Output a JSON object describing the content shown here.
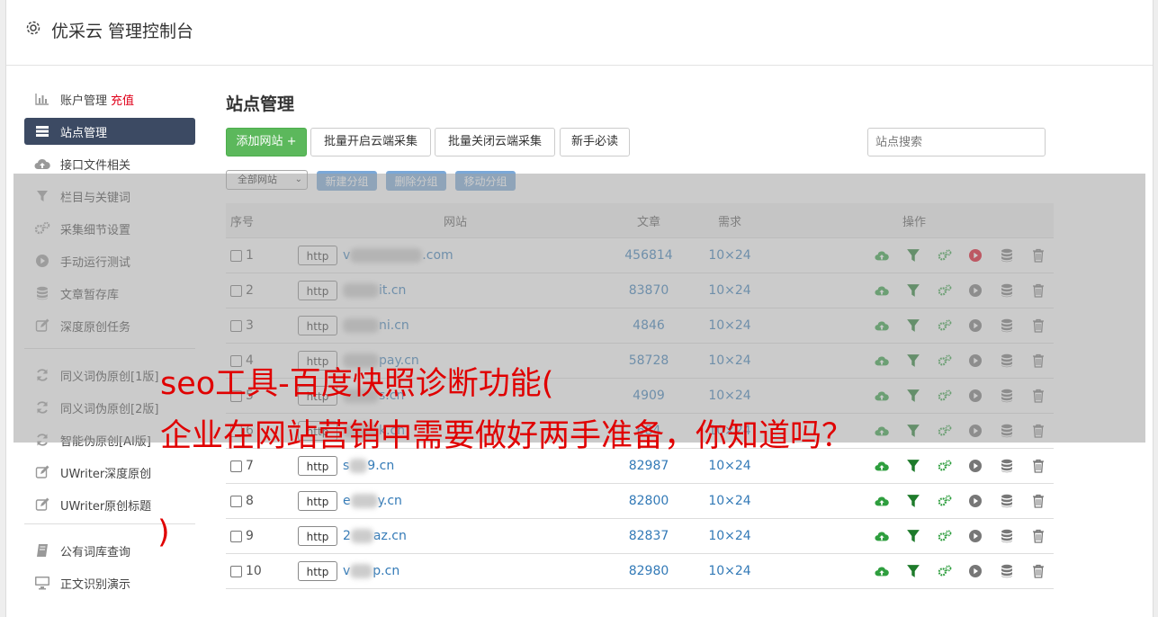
{
  "header": {
    "title": "优采云 管理控制台"
  },
  "sidebar": {
    "items": [
      {
        "label": "账户管理",
        "badge": "充值",
        "icon": "bar-chart-icon"
      },
      {
        "label": "站点管理",
        "icon": "server-icon",
        "active": true
      },
      {
        "label": "接口文件相关",
        "icon": "cloud-upload-icon"
      },
      {
        "label": "栏目与关键词",
        "icon": "filter-icon"
      },
      {
        "label": "采集细节设置",
        "icon": "gears-icon"
      },
      {
        "label": "手动运行测试",
        "icon": "play-icon"
      },
      {
        "label": "文章暂存库",
        "icon": "database-icon"
      },
      {
        "label": "深度原创任务",
        "icon": "edit-icon"
      }
    ],
    "items2": [
      {
        "label": "同义词伪原创[1版]",
        "icon": "refresh-icon"
      },
      {
        "label": "同义词伪原创[2版]",
        "icon": "refresh-icon"
      },
      {
        "label": "智能伪原创[AI版]",
        "icon": "refresh-icon"
      },
      {
        "label": "UWriter深度原创",
        "icon": "edit-icon"
      },
      {
        "label": "UWriter原创标题",
        "icon": "edit-icon"
      }
    ],
    "items3": [
      {
        "label": "公有词库查询",
        "icon": "book-icon"
      },
      {
        "label": "正文识别演示",
        "icon": "monitor-icon"
      }
    ]
  },
  "main": {
    "title": "站点管理",
    "buttons": {
      "add_site": "添加网站 +",
      "batch_open": "批量开启云端采集",
      "batch_close": "批量关闭云端采集",
      "guide": "新手必读"
    },
    "search_placeholder": "站点搜索",
    "group_select": "全部网站",
    "group_buttons": {
      "new": "新建分组",
      "delete": "删除分组",
      "move": "移动分组"
    },
    "table": {
      "headers": {
        "no": "序号",
        "site": "网站",
        "articles": "文章",
        "demand": "需求",
        "ops": "操作"
      },
      "rows": [
        {
          "no": "1",
          "protocol": "http",
          "site_prefix": "v",
          "site_suffix": ".com",
          "articles": "456814",
          "demand": "10×24"
        },
        {
          "no": "2",
          "protocol": "http",
          "site_prefix": "",
          "site_suffix": "it.cn",
          "articles": "83870",
          "demand": "10×24"
        },
        {
          "no": "3",
          "protocol": "http",
          "site_prefix": "",
          "site_suffix": "ni.cn",
          "articles": "4846",
          "demand": "10×24"
        },
        {
          "no": "4",
          "protocol": "http",
          "site_prefix": "",
          "site_suffix": "pay.cn",
          "articles": "58728",
          "demand": "10×24"
        },
        {
          "no": "5",
          "protocol": "http",
          "site_prefix": "",
          "site_suffix": "s.cn",
          "articles": "4909",
          "demand": "10×24"
        },
        {
          "no": "6",
          "protocol": "http",
          "site_prefix": "",
          "site_suffix": "k.cn",
          "articles": "684",
          "demand": "10×24"
        },
        {
          "no": "7",
          "protocol": "http",
          "site_prefix": "s",
          "site_suffix": "9.cn",
          "articles": "82987",
          "demand": "10×24"
        },
        {
          "no": "8",
          "protocol": "http",
          "site_prefix": "e",
          "site_suffix": "y.cn",
          "articles": "82800",
          "demand": "10×24"
        },
        {
          "no": "9",
          "protocol": "http",
          "site_prefix": "2",
          "site_suffix": "az.cn",
          "articles": "82837",
          "demand": "10×24"
        },
        {
          "no": "10",
          "protocol": "http",
          "site_prefix": "v",
          "site_suffix": "p.cn",
          "articles": "82980",
          "demand": "10×24"
        }
      ]
    }
  },
  "overlay": {
    "line1": "seo工具-百度快照诊断功能(",
    "line2": "企业在网站营销中需要做好两手准备，你知道吗？",
    "line3": ")"
  },
  "colors": {
    "active_nav": "#3c4a63",
    "green": "#5cb85c",
    "link": "#337ab7",
    "red_badge": "#e0001a",
    "overlay_text": "#e00000"
  }
}
